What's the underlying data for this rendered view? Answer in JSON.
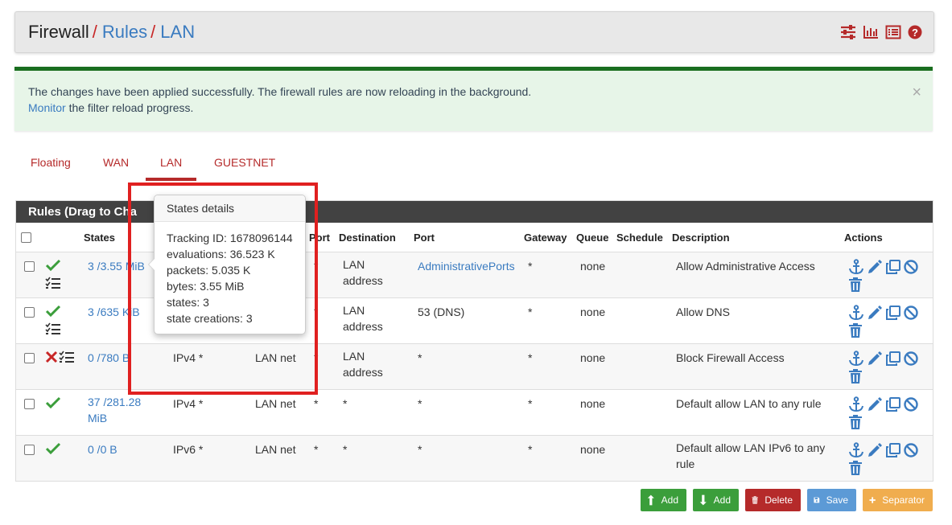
{
  "breadcrumb": {
    "root": "Firewall",
    "sep": "/",
    "item2": "Rules",
    "item3": "LAN"
  },
  "top_icons": [
    "sliders-icon",
    "bar-chart-icon",
    "list-icon",
    "help-icon"
  ],
  "alert": {
    "message": "The changes have been applied successfully. The firewall rules are now reloading in the background.",
    "link_text": "Monitor",
    "tail": " the filter reload progress.",
    "close": "×"
  },
  "tabs": [
    {
      "label": "Floating",
      "active": false
    },
    {
      "label": "WAN",
      "active": false
    },
    {
      "label": "LAN",
      "active": true
    },
    {
      "label": "GUESTNET",
      "active": false
    }
  ],
  "panel": {
    "title": "Rules (Drag to Change Order)",
    "visible_title": "Rules (Drag to Cha"
  },
  "columns": [
    "States",
    "Port",
    "Destination",
    "Port",
    "Gateway",
    "Queue",
    "Schedule",
    "Description",
    "Actions"
  ],
  "rules": [
    {
      "status": "pass",
      "states": "3 /3.55 MiB",
      "states_l1": "3 /3.55 MiB",
      "states_l2": "",
      "protocol": "",
      "source": "",
      "src_port": "*",
      "destination_l1": "LAN",
      "destination_l2": "address",
      "dst_port": "AdministrativePorts",
      "dst_port_link": true,
      "gateway": "*",
      "queue": "none",
      "schedule": "",
      "desc_l1": "Allow Administrative Access",
      "desc_l2": ""
    },
    {
      "status": "pass",
      "states": "3 /635 KiB",
      "states_l1": "3 /635 KiB",
      "states_l2": "",
      "protocol": "",
      "source": "",
      "src_port": "*",
      "destination_l1": "LAN",
      "destination_l2": "address",
      "dst_port": "53 (DNS)",
      "dst_port_link": false,
      "gateway": "*",
      "queue": "none",
      "schedule": "",
      "desc_l1": "Allow DNS",
      "desc_l2": ""
    },
    {
      "status": "block",
      "states": "0 /780 B",
      "states_l1": "0 /780 B",
      "states_l2": "",
      "protocol": "IPv4 *",
      "source": "LAN net",
      "src_port": "*",
      "destination_l1": "LAN",
      "destination_l2": "address",
      "dst_port": "*",
      "dst_port_link": false,
      "gateway": "*",
      "queue": "none",
      "schedule": "",
      "desc_l1": "Block Firewall Access",
      "desc_l2": ""
    },
    {
      "status": "pass",
      "states": "37 /281.28 MiB",
      "states_l1": "37 /281.28",
      "states_l2": "MiB",
      "protocol": "IPv4 *",
      "source": "LAN net",
      "src_port": "*",
      "destination_l1": "*",
      "destination_l2": "",
      "dst_port": "*",
      "dst_port_link": false,
      "gateway": "*",
      "queue": "none",
      "schedule": "",
      "desc_l1": "Default allow LAN to any rule",
      "desc_l2": ""
    },
    {
      "status": "pass",
      "states": "0 /0 B",
      "states_l1": "0 /0 B",
      "states_l2": "",
      "protocol": "IPv6 *",
      "source": "LAN net",
      "src_port": "*",
      "destination_l1": "*",
      "destination_l2": "",
      "dst_port": "*",
      "dst_port_link": false,
      "gateway": "*",
      "queue": "none",
      "schedule": "",
      "desc_l1": "Default allow LAN IPv6 to any",
      "desc_l2": "rule"
    }
  ],
  "tooltip": {
    "title": "States details",
    "lines": [
      "Tracking ID: 1678096144",
      "evaluations: 36.523 K",
      "packets: 5.035 K",
      "bytes: 3.55 MiB",
      "states: 3",
      "state creations: 3"
    ]
  },
  "buttons": [
    {
      "label": "Add",
      "color": "#3b9e3b",
      "icon": "arrow-up-icon"
    },
    {
      "label": "Add",
      "color": "#3b9e3b",
      "icon": "arrow-down-icon"
    },
    {
      "label": "Delete",
      "color": "#b52a2a",
      "icon": "trash-icon"
    },
    {
      "label": "Save",
      "color": "#5c9ad6",
      "icon": "save-icon"
    },
    {
      "label": "Separator",
      "color": "#f0ad4e",
      "icon": "plus-icon"
    }
  ],
  "colors": {
    "link": "#3a7bc0",
    "accent": "#b52a2a",
    "pass": "#3b9e3b",
    "block": "#c82727",
    "header": "#424242"
  }
}
